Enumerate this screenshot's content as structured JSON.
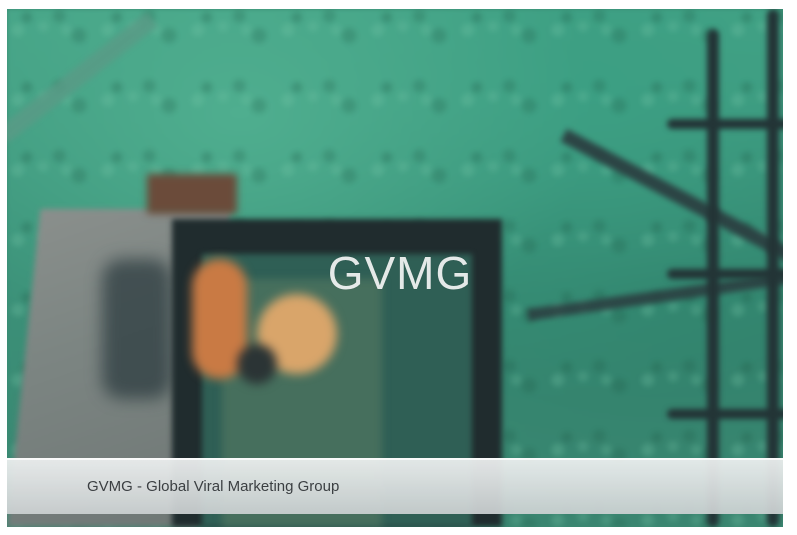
{
  "slide": {
    "center_text": "GVMG",
    "caption": "GVMG - Global Viral Marketing Group"
  },
  "colors": {
    "background_green": "#3a8a72",
    "caption_bar": "#e2e6e6",
    "caption_text": "#3b3f42",
    "logo_text": "#ffffff"
  }
}
